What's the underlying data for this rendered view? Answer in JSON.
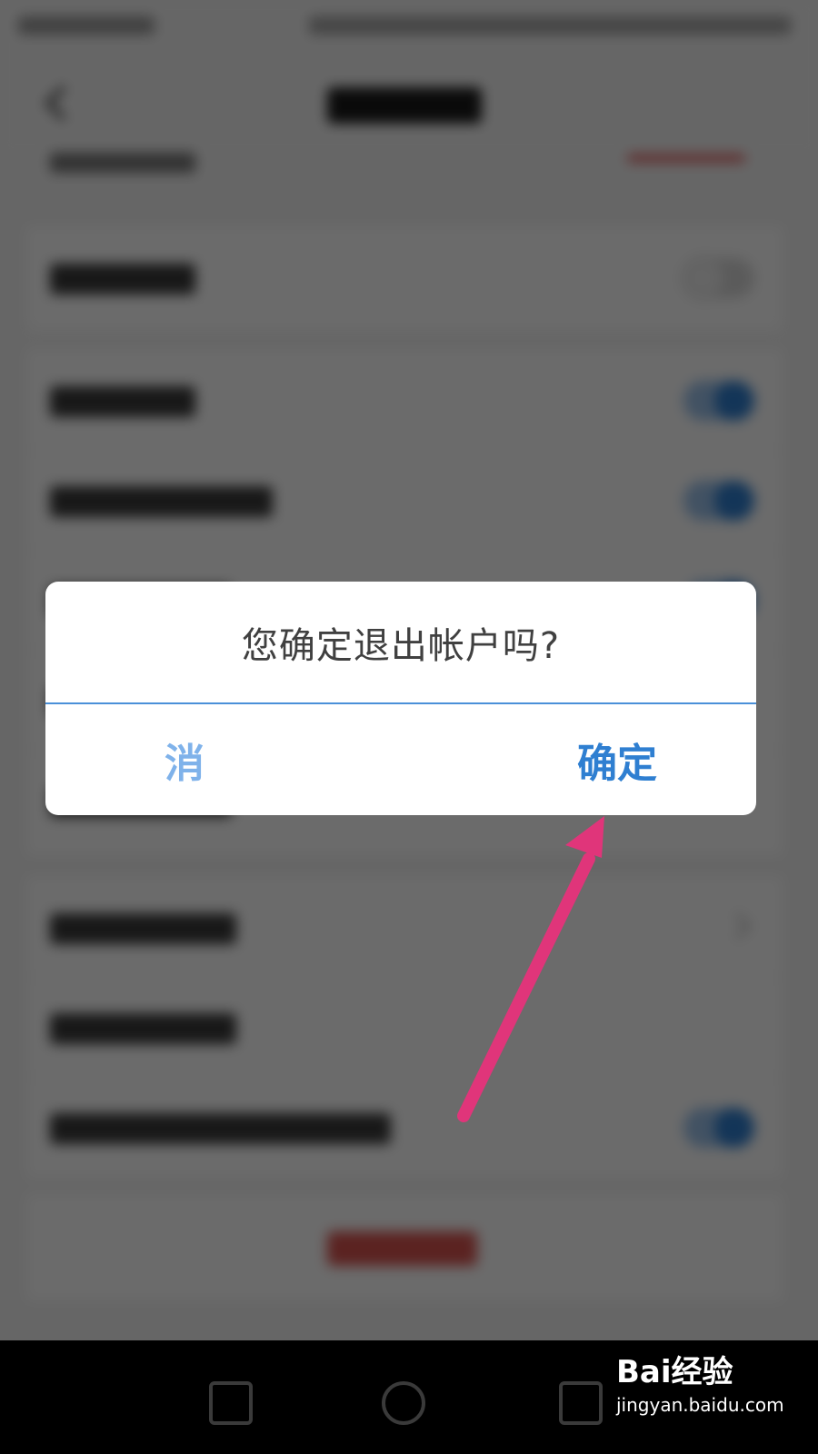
{
  "dialog": {
    "message": "您确定退出帐户吗?",
    "cancel_label": "消",
    "confirm_label": "确定"
  },
  "watermark": {
    "logo_text": "Bai经验",
    "url": "jingyan.baidu.com"
  },
  "colors": {
    "accent": "#2f7fd1",
    "annotation_arrow": "#e0357a",
    "overlay": "#000000"
  },
  "background_settings": {
    "toggles": [
      {
        "state": "off"
      },
      {
        "state": "on"
      },
      {
        "state": "on"
      },
      {
        "state": "on"
      }
    ]
  }
}
